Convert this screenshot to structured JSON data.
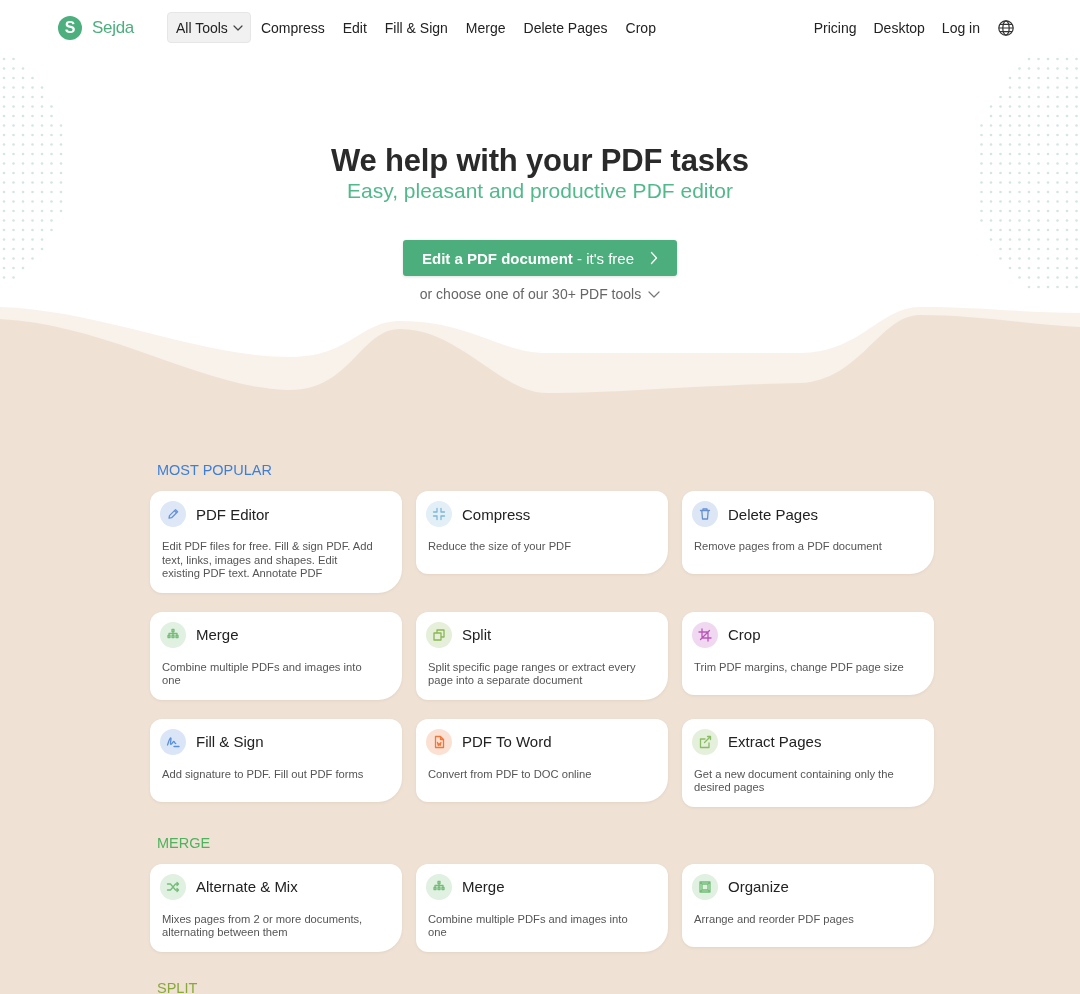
{
  "header": {
    "logo": {
      "mark": "S",
      "text": "Sejda"
    },
    "nav": [
      {
        "label": "All Tools",
        "kind": "dropdown"
      },
      {
        "label": "Compress",
        "kind": "link"
      },
      {
        "label": "Edit",
        "kind": "link"
      },
      {
        "label": "Fill & Sign",
        "kind": "link"
      },
      {
        "label": "Merge",
        "kind": "link"
      },
      {
        "label": "Delete Pages",
        "kind": "link"
      },
      {
        "label": "Crop",
        "kind": "link"
      }
    ],
    "account_nav": [
      {
        "label": "Pricing"
      },
      {
        "label": "Desktop"
      },
      {
        "label": "Log in"
      }
    ]
  },
  "hero": {
    "title": "We help with your PDF tasks",
    "subtitle": "Easy, pleasant and productive PDF editor",
    "cta": "**Edit a PDF document** - it's free",
    "tools_link": "or choose one of our 30+ PDF tools"
  },
  "sections": [
    {
      "title": "MOST POPULAR",
      "color": "#3d7fd6",
      "tools": [
        {
          "name": "PDF Editor",
          "description": "Edit PDF files for free. Fill & sign PDF. Add text, links, images and shapes. Edit existing PDF text. Annotate PDF",
          "color": "#dde7f6"
        },
        {
          "name": "Compress",
          "description": "Reduce the size of your PDF",
          "color": "#e2eff6"
        },
        {
          "name": "Delete Pages",
          "description": "Remove pages from a PDF document",
          "color": "#dde6f4"
        },
        {
          "name": "Merge",
          "description": "Combine multiple PDFs and images into one",
          "color": "#e0f0e1"
        },
        {
          "name": "Split",
          "description": "Split specific page ranges or extract every page into a separate document",
          "color": "#e5efd9"
        },
        {
          "name": "Crop",
          "description": "Trim PDF margins, change PDF page size",
          "color": "#f0d9f0"
        },
        {
          "name": "Fill & Sign",
          "description": "Add signature to PDF. Fill out PDF forms",
          "color": "#dae6f7"
        },
        {
          "name": "PDF To Word",
          "description": "Convert from PDF to DOC online",
          "color": "#fbe1d3"
        },
        {
          "name": "Extract Pages",
          "description": "Get a new document containing only the desired pages",
          "color": "#e5f0dc"
        }
      ]
    },
    {
      "title": "MERGE",
      "color": "#4db35c",
      "tools": [
        {
          "name": "Alternate & Mix",
          "description": "Mixes pages from 2 or more documents, alternating between them",
          "color": "#e0f0e1"
        },
        {
          "name": "Merge",
          "description": "Combine multiple PDFs and images into one",
          "color": "#e0f0e1"
        },
        {
          "name": "Organize",
          "description": "Arrange and reorder PDF pages",
          "color": "#e0f0e1"
        }
      ]
    },
    {
      "title": "SPLIT",
      "color": "#8aa83a"
    }
  ]
}
